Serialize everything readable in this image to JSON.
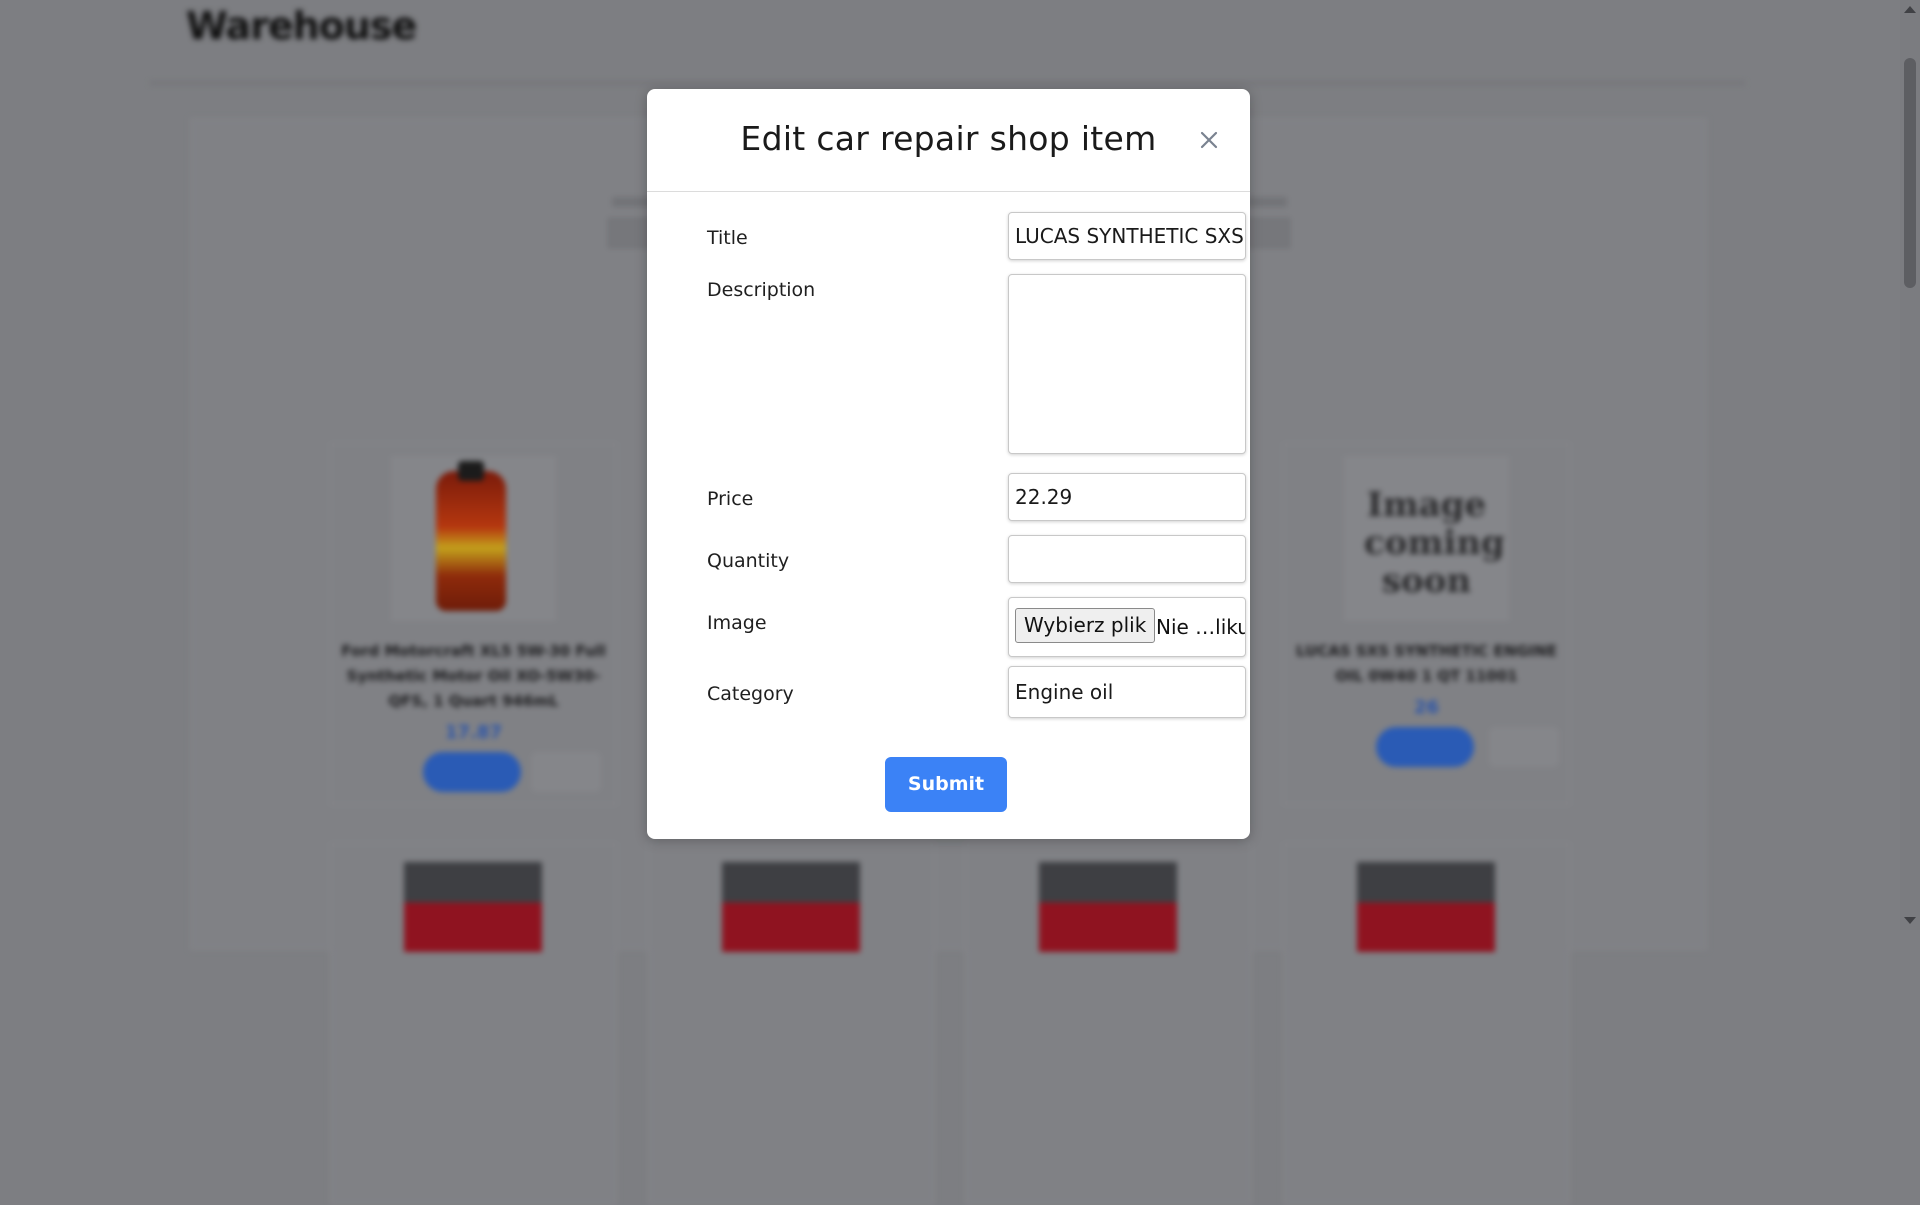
{
  "page": {
    "title": "Warehouse"
  },
  "modal": {
    "title": "Edit car repair shop item",
    "fields": {
      "title": {
        "label": "Title",
        "value": "LUCAS SYNTHETIC SXS E"
      },
      "description": {
        "label": "Description",
        "value": ""
      },
      "price": {
        "label": "Price",
        "value": "22.29"
      },
      "quantity": {
        "label": "Quantity",
        "value": ""
      },
      "image": {
        "label": "Image",
        "button_label": "Wybierz plik",
        "status": "Nie …liku"
      },
      "category": {
        "label": "Category",
        "value": "Engine oil"
      }
    },
    "submit_label": "Submit"
  },
  "background_cards": [
    {
      "text": "Ford Motorcraft XL5 5W-30 Full Synthetic Motor Oil XO-5W30-QFS, 1 Quart 946mL",
      "price": "17.87"
    },
    {
      "text": "LUCAS SXS SYNTHETIC ENGINE OIL 0W40 1 QT 11001",
      "price": "26",
      "image_text": "Image coming soon"
    }
  ],
  "icons": {
    "close": "close-icon"
  },
  "colors": {
    "accent": "#3b82f6",
    "overlay": "#7d7e82"
  }
}
